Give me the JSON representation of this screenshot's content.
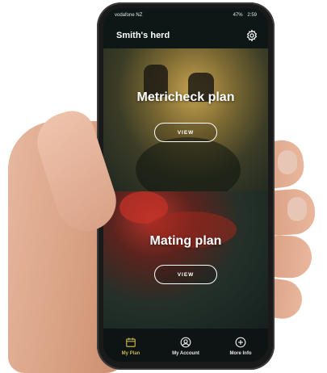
{
  "status_bar": {
    "carrier": "vodafone NZ",
    "indicators": "47%",
    "time": "2:59"
  },
  "app_bar": {
    "title": "Smith's herd",
    "settings_icon": "gear-icon"
  },
  "cards": [
    {
      "title": "Metricheck plan",
      "button": "VIEW"
    },
    {
      "title": "Mating plan",
      "button": "VIEW"
    }
  ],
  "nav": [
    {
      "label": "My Plan",
      "icon": "calendar-icon",
      "active": true
    },
    {
      "label": "My Account",
      "icon": "user-icon",
      "active": false
    },
    {
      "label": "More Info",
      "icon": "plus-circle-icon",
      "active": false
    }
  ],
  "colors": {
    "active_accent": "#c9b24a",
    "background": "#0c1716"
  }
}
